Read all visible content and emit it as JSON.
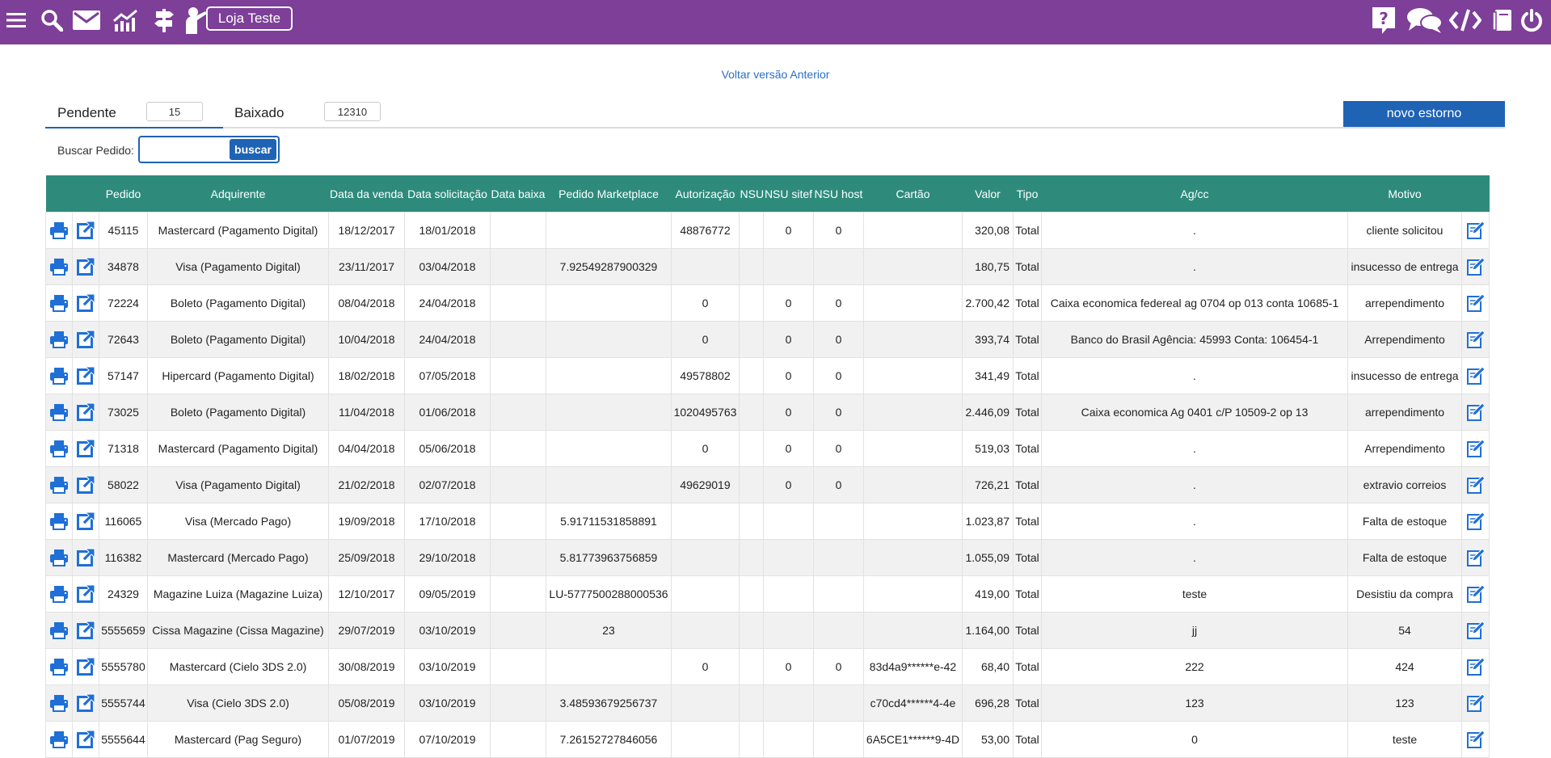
{
  "header": {
    "store_label": "Loja Teste",
    "accent": "#7d3f98",
    "left_icons": [
      "menu-icon",
      "search-icon",
      "mail-icon",
      "chart-icon",
      "signpost-icon",
      "user-presenter-icon"
    ],
    "right_icons": [
      "help-icon",
      "chat-icon",
      "code-icon",
      "book-icon",
      "power-icon"
    ]
  },
  "back_link": "Voltar versão Anterior",
  "tabs": [
    {
      "label": "Pendente",
      "count": "15"
    },
    {
      "label": "Baixado",
      "count": "12310"
    }
  ],
  "new_refund_label": "novo estorno",
  "search": {
    "label": "Buscar Pedido:",
    "button": "buscar",
    "value": ""
  },
  "table": {
    "header_color": "#2e8b7c",
    "columns": [
      "",
      "",
      "Pedido",
      "Adquirente",
      "Data da venda",
      "Data solicitação",
      "Data baixa",
      "Pedido Marketplace",
      "Autorização",
      "NSU",
      "NSU sitef",
      "NSU host",
      "Cartão",
      "Valor",
      "Tipo",
      "Ag/cc",
      "Motivo",
      ""
    ],
    "rows": [
      [
        "45115",
        "Mastercard (Pagamento Digital)",
        "18/12/2017",
        "18/01/2018",
        "",
        "",
        "48876772",
        "",
        "0",
        "0",
        "",
        "320,08",
        "Total",
        ".",
        "cliente solicitou"
      ],
      [
        "34878",
        "Visa (Pagamento Digital)",
        "23/11/2017",
        "03/04/2018",
        "",
        "7.92549287900329",
        "",
        "",
        "",
        "",
        "",
        "180,75",
        "Total",
        ".",
        "insucesso de entrega"
      ],
      [
        "72224",
        "Boleto (Pagamento Digital)",
        "08/04/2018",
        "24/04/2018",
        "",
        "",
        "0",
        "",
        "0",
        "0",
        "",
        "2.700,42",
        "Total",
        "Caixa economica federeal ag 0704 op 013 conta 10685-1",
        "arrependimento"
      ],
      [
        "72643",
        "Boleto (Pagamento Digital)",
        "10/04/2018",
        "24/04/2018",
        "",
        "",
        "0",
        "",
        "0",
        "0",
        "",
        "393,74",
        "Total",
        "Banco do Brasil Agência: 45993 Conta: 106454-1",
        "Arrependimento"
      ],
      [
        "57147",
        "Hipercard (Pagamento Digital)",
        "18/02/2018",
        "07/05/2018",
        "",
        "",
        "49578802",
        "",
        "0",
        "0",
        "",
        "341,49",
        "Total",
        ".",
        "insucesso de entrega"
      ],
      [
        "73025",
        "Boleto (Pagamento Digital)",
        "11/04/2018",
        "01/06/2018",
        "",
        "",
        "1020495763",
        "",
        "0",
        "0",
        "",
        "2.446,09",
        "Total",
        "Caixa economica Ag 0401 c/P 10509-2 op 13",
        "arrependimento"
      ],
      [
        "71318",
        "Mastercard (Pagamento Digital)",
        "04/04/2018",
        "05/06/2018",
        "",
        "",
        "0",
        "",
        "0",
        "0",
        "",
        "519,03",
        "Total",
        ".",
        "Arrependimento"
      ],
      [
        "58022",
        "Visa (Pagamento Digital)",
        "21/02/2018",
        "02/07/2018",
        "",
        "",
        "49629019",
        "",
        "0",
        "0",
        "",
        "726,21",
        "Total",
        ".",
        "extravio correios"
      ],
      [
        "116065",
        "Visa (Mercado Pago)",
        "19/09/2018",
        "17/10/2018",
        "",
        "5.91711531858891",
        "",
        "",
        "",
        "",
        "",
        "1.023,87",
        "Total",
        ".",
        "Falta de estoque"
      ],
      [
        "116382",
        "Mastercard (Mercado Pago)",
        "25/09/2018",
        "29/10/2018",
        "",
        "5.81773963756859",
        "",
        "",
        "",
        "",
        "",
        "1.055,09",
        "Total",
        ".",
        "Falta de estoque"
      ],
      [
        "24329",
        "Magazine Luiza (Magazine Luiza)",
        "12/10/2017",
        "09/05/2019",
        "",
        "LU-5777500288000536",
        "",
        "",
        "",
        "",
        "",
        "419,00",
        "Total",
        "teste",
        "Desistiu da compra"
      ],
      [
        "5555659",
        "Cissa Magazine (Cissa Magazine)",
        "29/07/2019",
        "03/10/2019",
        "",
        "23",
        "",
        "",
        "",
        "",
        "",
        "1.164,00",
        "Total",
        "jj",
        "54"
      ],
      [
        "5555780",
        "Mastercard (Cielo 3DS 2.0)",
        "30/08/2019",
        "03/10/2019",
        "",
        "",
        "0",
        "",
        "0",
        "0",
        "83d4a9******e-42",
        "68,40",
        "Total",
        "222",
        "424"
      ],
      [
        "5555744",
        "Visa (Cielo 3DS 2.0)",
        "05/08/2019",
        "03/10/2019",
        "",
        "3.48593679256737",
        "",
        "",
        "",
        "",
        "c70cd4******4-4e",
        "696,28",
        "Total",
        "123",
        "123"
      ],
      [
        "5555644",
        "Mastercard (Pag Seguro)",
        "01/07/2019",
        "07/10/2019",
        "",
        "7.26152727846056",
        "",
        "",
        "",
        "",
        "6A5CE1******9-4D",
        "53,00",
        "Total",
        "0",
        "teste"
      ]
    ],
    "row_icons": [
      "print-icon",
      "open-external-icon",
      "edit-icon"
    ]
  }
}
